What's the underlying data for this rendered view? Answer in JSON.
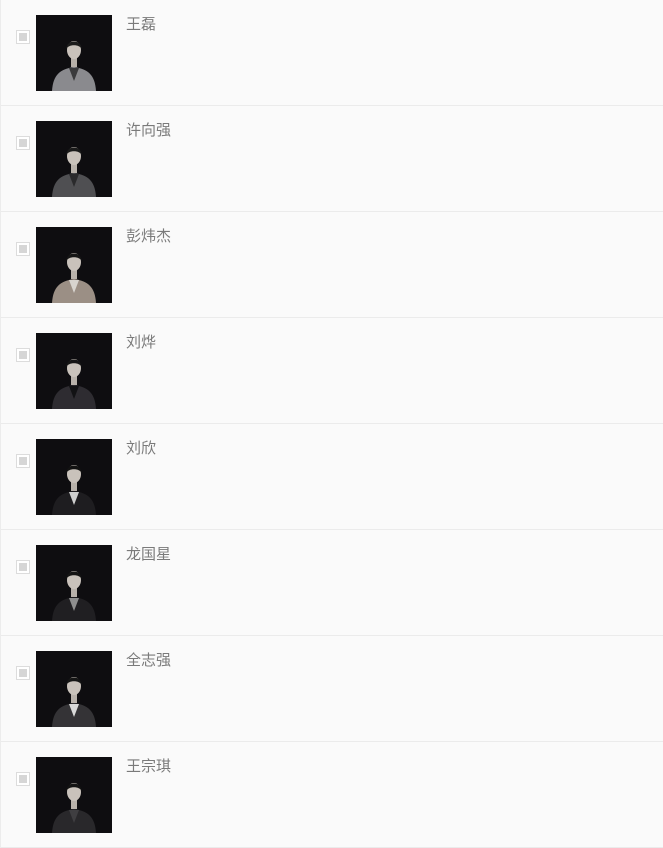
{
  "people": [
    {
      "name": "王磊",
      "coat": "#8a8a8e",
      "shirt": "#3a3a3c",
      "hair": "#1c1c1c"
    },
    {
      "name": "许向强",
      "coat": "#4f4f52",
      "shirt": "#2a2a2c",
      "hair": "#1a1a1a"
    },
    {
      "name": "彭炜杰",
      "coat": "#9b8f85",
      "shirt": "#d8d4cf",
      "hair": "#161616"
    },
    {
      "name": "刘烨",
      "coat": "#2e2c31",
      "shirt": "#121214",
      "hair": "#151515"
    },
    {
      "name": "刘欣",
      "coat": "#1e1d20",
      "shirt": "#cfcfcf",
      "hair": "#121212"
    },
    {
      "name": "龙国星",
      "coat": "#201f22",
      "shirt": "#8e8e8e",
      "hair": "#141414"
    },
    {
      "name": "全志强",
      "coat": "#343336",
      "shirt": "#d9d9d9",
      "hair": "#151515"
    },
    {
      "name": "王宗琪",
      "coat": "#29282b",
      "shirt": "#3f3e41",
      "hair": "#131313"
    }
  ]
}
